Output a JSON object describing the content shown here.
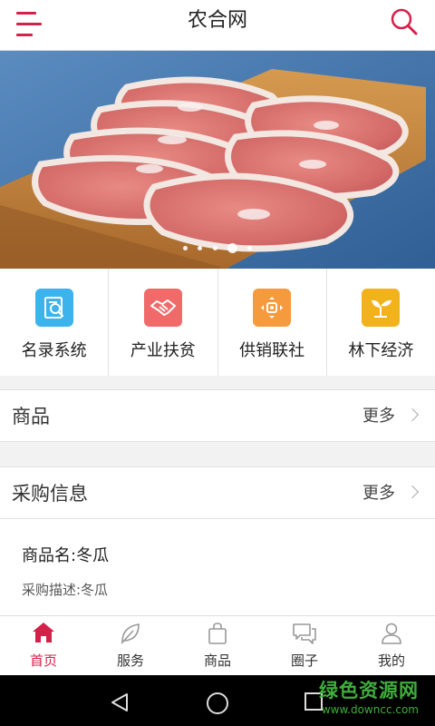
{
  "header": {
    "title": "农合网",
    "menu_icon": "menu-icon",
    "search_icon": "search-icon"
  },
  "banner": {
    "image": "sliced pork chops on wooden board",
    "slide_count": 5,
    "active_slide": 4
  },
  "quick_links": [
    {
      "label": "名录系统",
      "icon": "directory-search-icon",
      "color": "#3cb3ec"
    },
    {
      "label": "产业扶贫",
      "icon": "handshake-icon",
      "color": "#f06a6a"
    },
    {
      "label": "供销联社",
      "icon": "supply-marketing-icon",
      "color": "#f59a3d"
    },
    {
      "label": "林下经济",
      "icon": "sprout-icon",
      "color": "#f2b21c"
    }
  ],
  "sections": {
    "products": {
      "title": "商品",
      "more": "更多"
    },
    "purchase": {
      "title": "采购信息",
      "more": "更多"
    }
  },
  "purchase_item": {
    "name": "商品名:冬瓜",
    "description": "采购描述:冬瓜"
  },
  "tabbar": [
    {
      "label": "首页",
      "icon": "home-icon",
      "active": true
    },
    {
      "label": "服务",
      "icon": "leaf-icon",
      "active": false
    },
    {
      "label": "商品",
      "icon": "shopping-bag-icon",
      "active": false
    },
    {
      "label": "圈子",
      "icon": "chat-bubbles-icon",
      "active": false
    },
    {
      "label": "我的",
      "icon": "user-icon",
      "active": false
    }
  ],
  "watermark": {
    "name": "绿色资源网",
    "url": "www.downcc.com"
  },
  "colors": {
    "accent": "#d4214a",
    "watermark": "#3fae3c"
  }
}
